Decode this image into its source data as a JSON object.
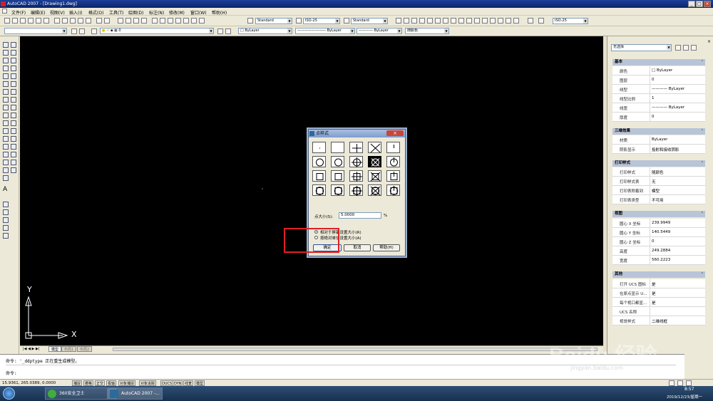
{
  "window": {
    "title": "AutoCAD 2007 - [Drawing1.dwg]",
    "min": "_",
    "max": "□",
    "close": "×"
  },
  "menu": [
    "文件(F)",
    "编辑(E)",
    "视图(V)",
    "插入(I)",
    "格式(O)",
    "工具(T)",
    "绘图(D)",
    "标注(N)",
    "修改(M)",
    "窗口(W)",
    "帮助(H)"
  ],
  "toolbar": {
    "text_style": "Standard",
    "dim_style": "ISO-25",
    "table_style": "Standard",
    "dim_style2": "ISO-25",
    "layer": "0",
    "color": "ByLayer",
    "linetype": "ByLayer",
    "lineweight": "ByLayer",
    "plotstyle": "随颜色"
  },
  "layout_tabs": [
    "模型",
    "布局1",
    "布局2"
  ],
  "ucs": {
    "x": "X",
    "y": "Y"
  },
  "properties": {
    "selection": "无选择",
    "sections": [
      {
        "title": "基本",
        "rows": [
          {
            "k": "颜色",
            "v": "□ ByLayer"
          },
          {
            "k": "图层",
            "v": "0"
          },
          {
            "k": "线型",
            "v": "———— ByLayer"
          },
          {
            "k": "线型比例",
            "v": "1"
          },
          {
            "k": "线宽",
            "v": "———— ByLayer"
          },
          {
            "k": "厚度",
            "v": "0"
          }
        ]
      },
      {
        "title": "三维效果",
        "rows": [
          {
            "k": "材质",
            "v": "ByLayer"
          },
          {
            "k": "阴影显示",
            "v": "投射和接收阴影"
          }
        ]
      },
      {
        "title": "打印样式",
        "rows": [
          {
            "k": "打印样式",
            "v": "随颜色"
          },
          {
            "k": "打印样式表",
            "v": "无"
          },
          {
            "k": "打印表附着到",
            "v": "模型"
          },
          {
            "k": "打印表类型",
            "v": "不可用"
          }
        ]
      },
      {
        "title": "视图",
        "rows": [
          {
            "k": "圆心 X 坐标",
            "v": "239.9949"
          },
          {
            "k": "圆心 Y 坐标",
            "v": "140.5449"
          },
          {
            "k": "圆心 Z 坐标",
            "v": "0"
          },
          {
            "k": "高度",
            "v": "249.2884"
          },
          {
            "k": "宽度",
            "v": "560.2223"
          }
        ]
      },
      {
        "title": "其他",
        "rows": [
          {
            "k": "打开 UCS 图标",
            "v": "是"
          },
          {
            "k": "在原点显示 U...",
            "v": "是"
          },
          {
            "k": "每个视口都显...",
            "v": "是"
          },
          {
            "k": "UCS 名称",
            "v": ""
          },
          {
            "k": "视觉样式",
            "v": "二维线框"
          }
        ]
      }
    ]
  },
  "dialog": {
    "title": "点样式",
    "size_label": "点大小(S):",
    "size_value": "5.0000",
    "size_unit": "%",
    "radio_relative": "相对于屏幕设置大小(R)",
    "radio_absolute": "按绝对单位设置大小(A)",
    "ok": "确定",
    "cancel": "取消",
    "help": "帮助(H)"
  },
  "command": {
    "line1": "命令: '_ddptype 正在重生成模型。",
    "line2": "命令:"
  },
  "status": {
    "coords": "15.9361, 265.0389, 0.0000",
    "buttons": [
      "捕捉",
      "栅格",
      "正交",
      "极轴",
      "对象捕捉",
      "对象追踪",
      "DUCS",
      "DYN",
      "线宽",
      "模型"
    ]
  },
  "taskbar": {
    "apps": [
      "360安全卫士",
      "AutoCAD 2007 -..."
    ],
    "time": "8:57",
    "date": "2019/12/23/星期一"
  },
  "watermark": {
    "brand": "Baidu 经验",
    "url": "jingyan.baidu.com"
  }
}
